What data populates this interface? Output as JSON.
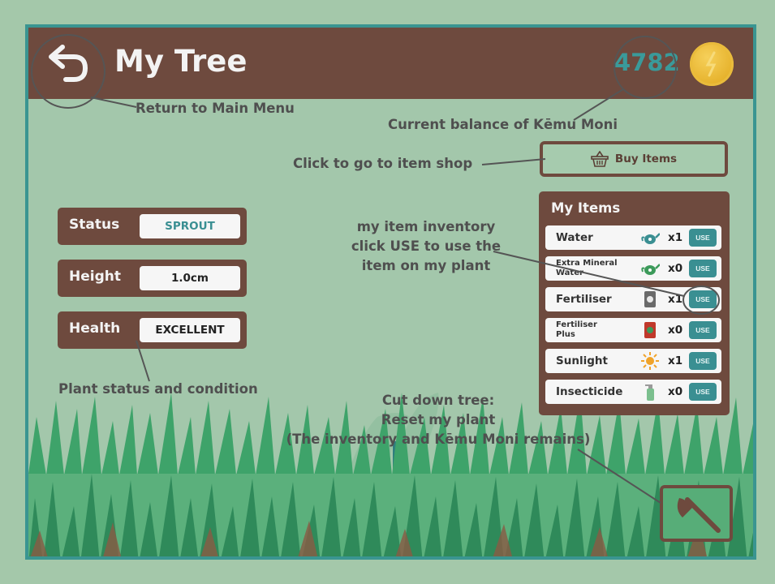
{
  "header": {
    "title": "My Tree",
    "balance": "4782"
  },
  "annotations": {
    "return": "Return to Main Menu",
    "balance": "Current balance of Kēmu Moni",
    "shop": "Click to go to item shop",
    "inventory": [
      "my item inventory",
      "click USE to use the",
      "item on my plant"
    ],
    "status": "Plant status and condition",
    "cutdown": [
      "Cut down tree:",
      "Reset my plant",
      "(The inventory and Kēmu Moni remains)"
    ]
  },
  "shop": {
    "label": "Buy Items"
  },
  "stats": [
    {
      "label": "Status",
      "value": "SPROUT",
      "value_color": "#3a8f92"
    },
    {
      "label": "Height",
      "value": "1.0cm",
      "value_color": "#222222"
    },
    {
      "label": "Health",
      "value": "EXCELLENT",
      "value_color": "#222222"
    }
  ],
  "inventory": {
    "title": "My Items",
    "use_label": "USE",
    "items": [
      {
        "name": "Water",
        "qty": "x1",
        "icon": "watering-can-icon"
      },
      {
        "name": "Extra Mineral Water",
        "qty": "x0",
        "icon": "watering-can-icon"
      },
      {
        "name": "Fertiliser",
        "qty": "x1",
        "icon": "fertiliser-bag-icon"
      },
      {
        "name": "Fertiliser Plus",
        "qty": "x0",
        "icon": "fertiliser-bag-icon"
      },
      {
        "name": "Sunlight",
        "qty": "x1",
        "icon": "sun-icon"
      },
      {
        "name": "Insecticide",
        "qty": "x0",
        "icon": "spray-bottle-icon"
      }
    ]
  },
  "cutdown": {
    "icon": "axe-icon"
  },
  "colors": {
    "header": "#6e4a3e",
    "background": "#a3c7ab",
    "accent": "#3a8f92",
    "coin": "#e6b22c"
  }
}
